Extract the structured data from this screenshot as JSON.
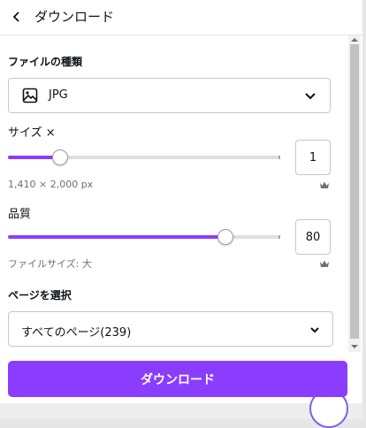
{
  "header": {
    "back_icon": "chevron-left-icon",
    "title": "ダウンロード"
  },
  "file_type": {
    "label": "ファイルの種類",
    "icon": "image-icon",
    "value": "JPG"
  },
  "size": {
    "label": "サイズ ×",
    "value": "1",
    "slider_fraction": 0.19,
    "dimensions": "1,410 × 2,000 px",
    "premium_icon": "crown-icon"
  },
  "quality": {
    "label": "品質",
    "value": "80",
    "slider_fraction": 0.8,
    "file_size": "ファイルサイズ: 大",
    "premium_icon": "crown-icon"
  },
  "pages": {
    "label": "ページを選択",
    "value": "すべてのページ(239)"
  },
  "download_button": "ダウンロード",
  "colors": {
    "accent": "#8b3dff",
    "text": "#0e1318",
    "muted": "#6b7078"
  }
}
